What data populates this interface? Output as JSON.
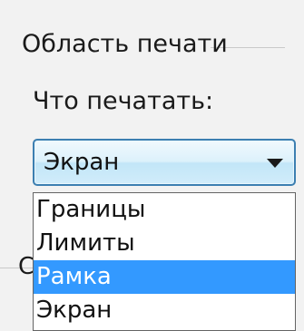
{
  "print_area": {
    "group_title": "Область печати",
    "what_to_print_label": "Что печатать:",
    "combo": {
      "selected_value": "Экран",
      "arrow_icon": "chevron-down-icon"
    },
    "dropdown": {
      "items": [
        {
          "label": "Границы",
          "selected": false
        },
        {
          "label": "Лимиты",
          "selected": false
        },
        {
          "label": "Рамка",
          "selected": true
        },
        {
          "label": "Экран",
          "selected": false
        }
      ],
      "highlight_color": "#3399ff"
    }
  },
  "next_group": {
    "partial_title": "С"
  },
  "colors": {
    "combo_border": "#3c7fb1",
    "combo_fill": "#dcf1fb",
    "panel_background": "#f2f2f2"
  }
}
